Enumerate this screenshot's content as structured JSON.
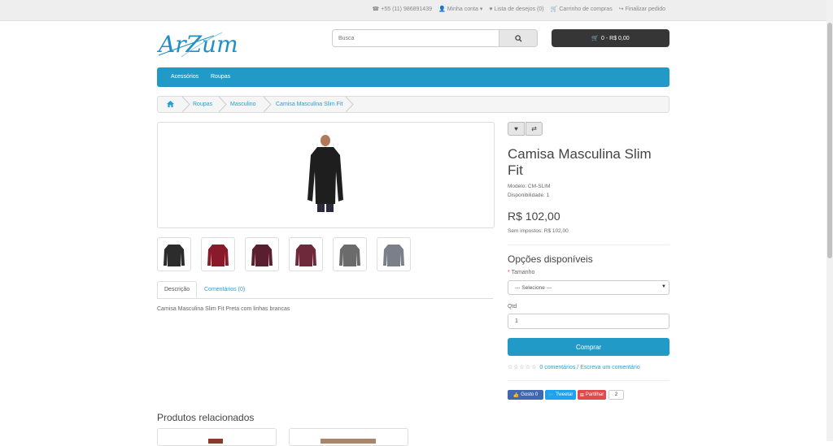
{
  "topbar": {
    "phone": "+55 (11) 986891439",
    "account": "Minha conta",
    "wishlist": "Lista de desejos (0)",
    "cart": "Carrinho de compras",
    "checkout": "Finalizar pedido"
  },
  "logo": {
    "text": "ArZum"
  },
  "search": {
    "placeholder": "Busca"
  },
  "cart_button": {
    "label": "0 - R$ 0,00"
  },
  "menu": {
    "items": [
      "Acessórios",
      "Roupas"
    ]
  },
  "breadcrumb": {
    "items": [
      "Roupas",
      "Masculino",
      "Camisa Masculina Slim Fit"
    ]
  },
  "product": {
    "title": "Camisa Masculina Slim Fit",
    "model": "Modelo: CM-SLIM",
    "availability": "Disponibilidade: 1",
    "price": "R$ 102,00",
    "ex_tax": "Sem impostos: R$ 102,00",
    "thumb_colors": [
      "#2c2c2c",
      "#8a1a2a",
      "#5a1f2e",
      "#6e2a3a",
      "#6b6b6b",
      "#7a7f8a"
    ]
  },
  "tabs": {
    "description": "Descrição",
    "reviews": "Comentários (0)"
  },
  "description_text": "Camisa Masculina Slim Fit Preta com linhas brancas",
  "related": {
    "title": "Produtos relacionados"
  },
  "options": {
    "heading": "Opções disponíveis",
    "size_label": "Tamanho",
    "size_value": "--- Selecione ---",
    "qty_label": "Qtd",
    "qty_value": "1",
    "buy_label": "Comprar"
  },
  "reviews": {
    "link": "0 comentários / Escreva um comentário"
  },
  "share": {
    "like": "Gosto 0",
    "tweet": "Tweetar",
    "share": "Partilhar",
    "count": "2"
  },
  "colors": {
    "accent": "#229ac8",
    "dark": "#363636",
    "link": "#23a1d1"
  }
}
